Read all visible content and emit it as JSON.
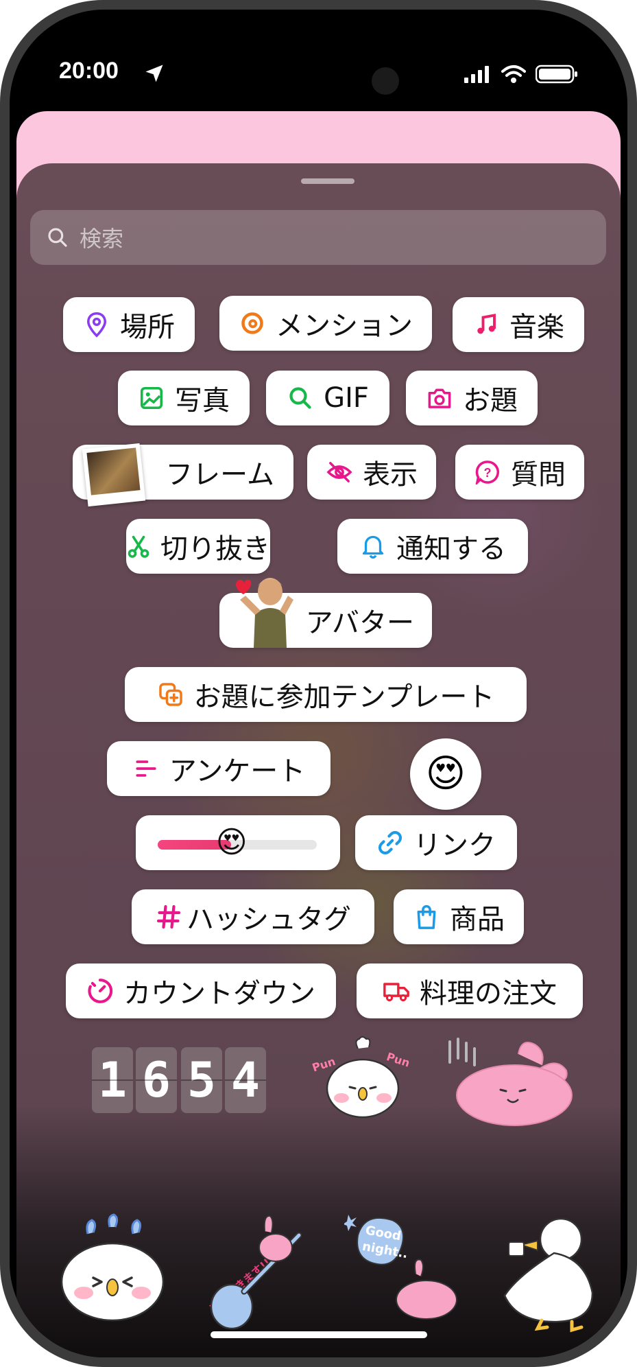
{
  "status_bar": {
    "time": "20:00"
  },
  "search": {
    "placeholder": "検索"
  },
  "stickers": {
    "location": "場所",
    "mention": "メンション",
    "music": "音楽",
    "photo": "写真",
    "gif": "GIF",
    "prompt": "お題",
    "frame": "フレーム",
    "reveal": "表示",
    "questions": "質問",
    "cutout": "切り抜き",
    "notify": "通知する",
    "avatar": "アバター",
    "add_yours_template": "お題に参加テンプレート",
    "poll": "アンケート",
    "link": "リンク",
    "hashtag": "ハッシュタグ",
    "product": "商品",
    "countdown": "カウントダウン",
    "food_order": "料理の注文"
  },
  "emoji_slider": {
    "emoji": "😍",
    "fill_fraction": 0.46
  },
  "emoji_reaction": {
    "emoji": "😍"
  },
  "flip_clock": {
    "digits": [
      "1",
      "6",
      "5",
      "4"
    ]
  },
  "icons": {
    "location": "map-pin-icon",
    "mention": "threads-icon",
    "music": "music-note-icon",
    "photo": "image-icon",
    "gif": "search-icon",
    "prompt": "camera-icon",
    "reveal": "eye-off-icon",
    "questions": "question-bubble-icon",
    "cutout": "scissors-icon",
    "notify": "bell-icon",
    "add_yours_template": "add-template-icon",
    "poll": "poll-lines-icon",
    "link": "link-icon",
    "hashtag": "hashtag-icon",
    "product": "shopping-bag-icon",
    "countdown": "timer-icon",
    "food_order": "delivery-truck-icon"
  },
  "colors": {
    "pink_card": "#fcc6de",
    "sheet": "#654a55",
    "accent_pink": "#e8178c"
  }
}
